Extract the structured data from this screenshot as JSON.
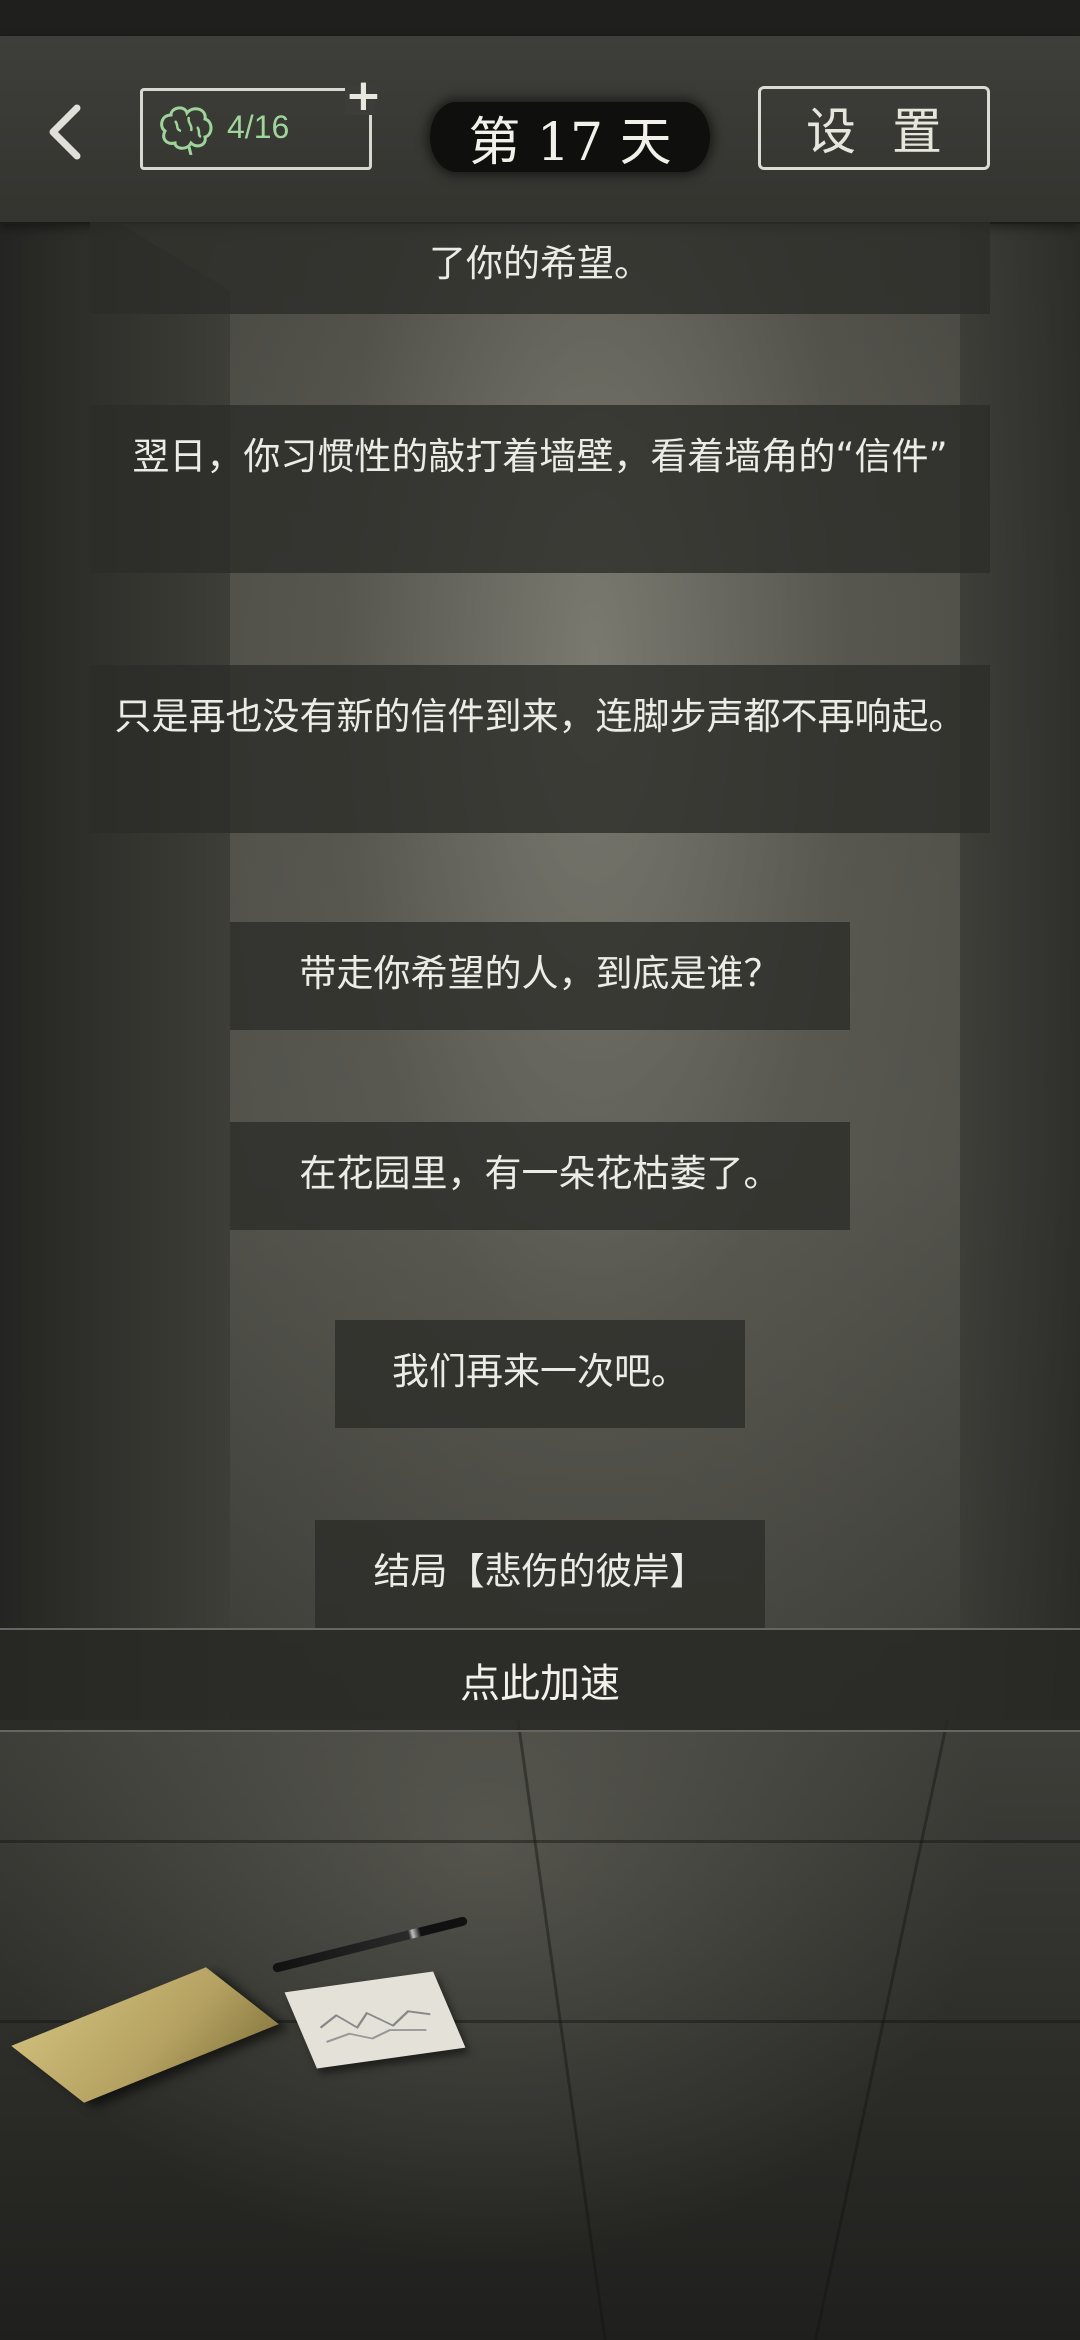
{
  "header": {
    "back_icon": "chevron-left-icon",
    "energy": {
      "value": "4/16",
      "icon": "brain-icon",
      "add_label": "+"
    },
    "day_label": "第 17 天",
    "settings_label": "设置"
  },
  "messages": [
    {
      "text": "了你的希望。"
    },
    {
      "text": "翌日，你习惯性的敲打着墙壁，看着墙角的“信件”"
    },
    {
      "text": "只是再也没有新的信件到来，连脚步声都不再响起。"
    },
    {
      "text": "带走你希望的人，到底是谁？"
    },
    {
      "text": "在花园里，有一朵花枯萎了。"
    },
    {
      "text": "我们再来一次吧。"
    },
    {
      "text": "结局【悲伤的彼岸】"
    }
  ],
  "speedup_label": "点此加速",
  "colors": {
    "energy_text": "#9fd59b",
    "background": "#3c3c37",
    "message_bg": "#2c2c28"
  }
}
